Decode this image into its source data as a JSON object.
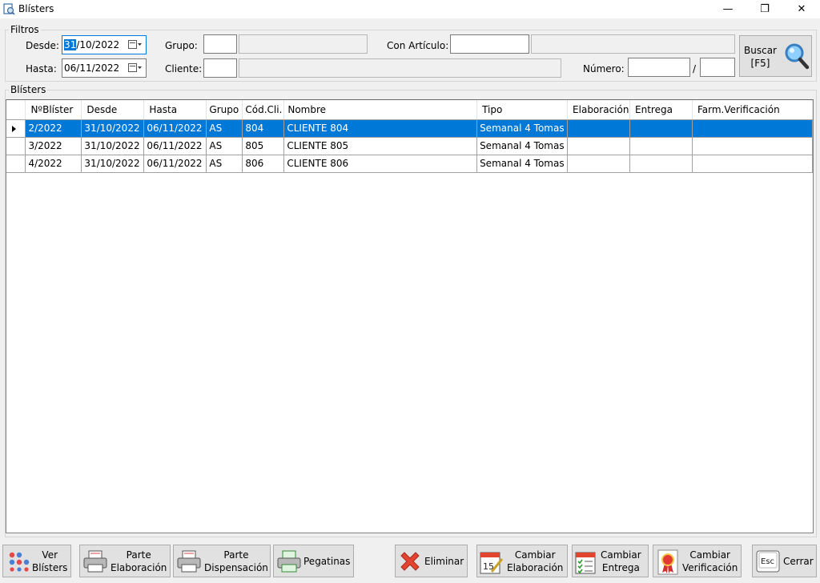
{
  "window": {
    "title": "Blísters",
    "minimize": "—",
    "maximize": "❐",
    "close": "✕"
  },
  "filters": {
    "group_title": "Filtros",
    "desde_label": "Desde:",
    "desde_sel": "31",
    "desde_rest": "/10/2022",
    "hasta_label": "Hasta:",
    "hasta_value": "06/11/2022",
    "grupo_label": "Grupo:",
    "grupo_code": "",
    "grupo_name": "",
    "cliente_label": "Cliente:",
    "cliente_code": "",
    "cliente_name": "",
    "articulo_label": "Con Artículo:",
    "articulo_code": "",
    "articulo_name": "",
    "numero_label": "Número:",
    "numero_value": "",
    "numero_sep": "/",
    "numero_year": "",
    "buscar_label": "Buscar",
    "buscar_key": "[F5]"
  },
  "grid": {
    "group_title": "Blísters",
    "columns": [
      "NºBlíster",
      "Desde",
      "Hasta",
      "Grupo",
      "Cód.Cli.",
      "Nombre",
      "Tipo",
      "Elaboración",
      "Entrega",
      "Farm.Verificación"
    ],
    "rows": [
      [
        "2/2022",
        "31/10/2022",
        "06/11/2022",
        "AS",
        "804",
        "CLIENTE 804",
        "Semanal 4 Tomas",
        "",
        "",
        ""
      ],
      [
        "3/2022",
        "31/10/2022",
        "06/11/2022",
        "AS",
        "805",
        "CLIENTE 805",
        "Semanal 4 Tomas",
        "",
        "",
        ""
      ],
      [
        "4/2022",
        "31/10/2022",
        "06/11/2022",
        "AS",
        "806",
        "CLIENTE 806",
        "Semanal 4 Tomas",
        "",
        "",
        ""
      ]
    ],
    "selected_row": 0
  },
  "toolbar": {
    "ver_blisters_1": "Ver",
    "ver_blisters_2": "Blísters",
    "parte_elab_1": "Parte",
    "parte_elab_2": "Elaboración",
    "parte_disp_1": "Parte",
    "parte_disp_2": "Dispensación",
    "pegatinas": "Pegatinas",
    "eliminar": "Eliminar",
    "cambiar_elab_1": "Cambiar",
    "cambiar_elab_2": "Elaboración",
    "cambiar_elab_icon_text": "15",
    "cambiar_entrega_1": "Cambiar",
    "cambiar_entrega_2": "Entrega",
    "cambiar_verif_1": "Cambiar",
    "cambiar_verif_2": "Verificación",
    "esc_icon_text": "Esc",
    "cerrar": "Cerrar"
  },
  "colors": {
    "accent": "#0078d7",
    "delete": "#e2442f"
  }
}
